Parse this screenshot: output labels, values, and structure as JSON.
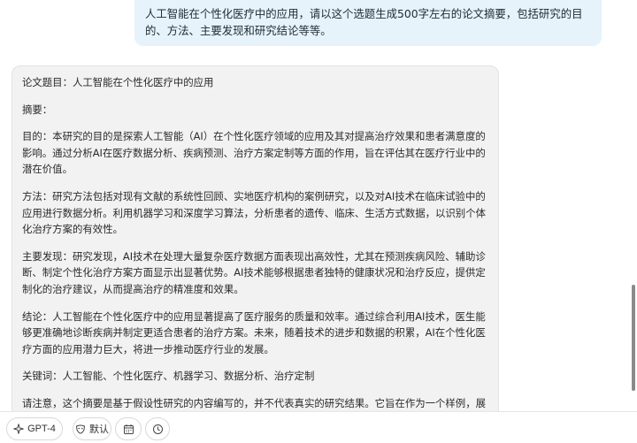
{
  "user_message": {
    "text": "人工智能在个性化医疗中的应用，请以这个选题生成500字左右的论文摘要，包括研究的目的、方法、主要发现和研究结论等等。"
  },
  "assistant_message": {
    "paragraphs": [
      "论文题目：人工智能在个性化医疗中的应用",
      "摘要：",
      "目的：本研究的目的是探索人工智能（AI）在个性化医疗领域的应用及其对提高治疗效果和患者满意度的影响。通过分析AI在医疗数据分析、疾病预测、治疗方案定制等方面的作用，旨在评估其在医疗行业中的潜在价值。",
      "方法：研究方法包括对现有文献的系统性回顾、实地医疗机构的案例研究，以及对AI技术在临床试验中的应用进行数据分析。利用机器学习和深度学习算法，分析患者的遗传、临床、生活方式数据，以识别个体化治疗方案的有效性。",
      "主要发现：研究发现，AI技术在处理大量复杂医疗数据方面表现出高效性，尤其在预测疾病风险、辅助诊断、制定个性化治疗方案方面显示出显著优势。AI技术能够根据患者独特的健康状况和治疗反应，提供定制化的治疗建议，从而提高治疗的精准度和效果。",
      "结论：人工智能在个性化医疗中的应用显著提高了医疗服务的质量和效率。通过综合利用AI技术，医生能够更准确地诊断疾病并制定更适合患者的治疗方案。未来，随着技术的进步和数据的积累，AI在个性化医疗方面的应用潜力巨大，将进一步推动医疗行业的发展。",
      "关键词：人工智能、个性化医疗、机器学习、数据分析、治疗定制",
      "请注意，这个摘要是基于假设性研究的内容编写的，并不代表真实的研究结果。它旨在作为一个样例，展示如何撰写关于“人工智能在个性化医疗中的应用”的研究摘要。"
    ]
  },
  "toolbar": {
    "model_label": "GPT-4",
    "default_label": "默认",
    "icons": {
      "model": "sparkle-icon",
      "default": "mask-icon",
      "calendar": "calendar-icon",
      "history": "clock-icon"
    }
  },
  "colors": {
    "user_bubble_bg": "#e6f3fb",
    "assistant_bubble_bg": "#f2f2f2"
  }
}
